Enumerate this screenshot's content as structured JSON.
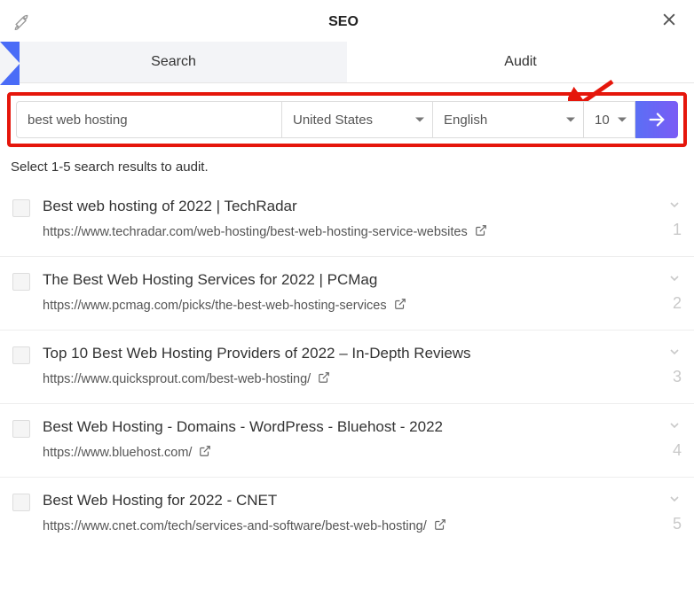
{
  "header": {
    "title": "SEO"
  },
  "tabs": {
    "search": "Search",
    "audit": "Audit"
  },
  "filters": {
    "query": "best web hosting",
    "country": "United States",
    "language": "English",
    "count": "10"
  },
  "instruction": "Select 1-5 search results to audit.",
  "results": [
    {
      "title": "Best web hosting of 2022 | TechRadar",
      "url": "https://www.techradar.com/web-hosting/best-web-hosting-service-websites",
      "rank": "1"
    },
    {
      "title": "The Best Web Hosting Services for 2022 | PCMag",
      "url": "https://www.pcmag.com/picks/the-best-web-hosting-services",
      "rank": "2"
    },
    {
      "title": "Top 10 Best Web Hosting Providers of 2022 – In-Depth Reviews",
      "url": "https://www.quicksprout.com/best-web-hosting/",
      "rank": "3"
    },
    {
      "title": "Best Web Hosting - Domains - WordPress - Bluehost - 2022",
      "url": "https://www.bluehost.com/",
      "rank": "4"
    },
    {
      "title": "Best Web Hosting for 2022 - CNET",
      "url": "https://www.cnet.com/tech/services-and-software/best-web-hosting/",
      "rank": "5"
    }
  ]
}
